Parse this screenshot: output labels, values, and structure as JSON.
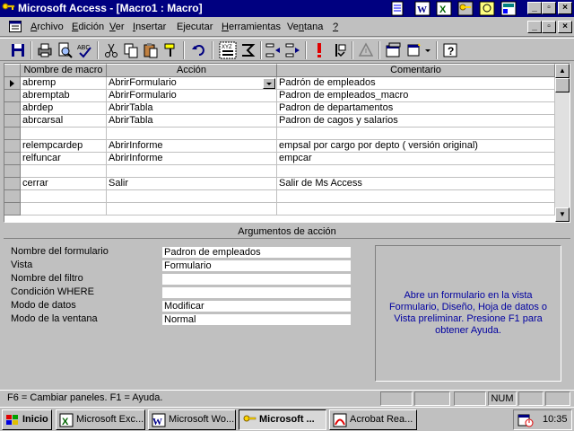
{
  "window": {
    "title": "Microsoft Access - [Macro1 : Macro]",
    "minimize": "_",
    "maximize": "▫",
    "close": "×"
  },
  "menu": {
    "items": [
      {
        "pre": "",
        "ul": "A",
        "post": "rchivo"
      },
      {
        "pre": "",
        "ul": "E",
        "post": "dición"
      },
      {
        "pre": "",
        "ul": "V",
        "post": "er"
      },
      {
        "pre": "",
        "ul": "I",
        "post": "nsertar"
      },
      {
        "pre": "E",
        "ul": "j",
        "post": "ecutar"
      },
      {
        "pre": "",
        "ul": "H",
        "post": "erramientas"
      },
      {
        "pre": "Ve",
        "ul": "n",
        "post": "tana"
      },
      {
        "pre": "",
        "ul": "?",
        "post": ""
      }
    ]
  },
  "grid": {
    "headers": [
      "Nombre de macro",
      "Acción",
      "Comentario"
    ],
    "rows": [
      {
        "name": "abremp",
        "action": "AbrirFormulario",
        "comment": "Padrón de empleados"
      },
      {
        "name": "abremptab",
        "action": "AbrirFormulario",
        "comment": "Padron de empleados_macro"
      },
      {
        "name": "abrdep",
        "action": "AbrirTabla",
        "comment": "Padron de departamentos"
      },
      {
        "name": "abrcarsal",
        "action": "AbrirTabla",
        "comment": "Padron de cagos y salarios"
      },
      {
        "name": "",
        "action": "",
        "comment": ""
      },
      {
        "name": "relempcardep",
        "action": "AbrirInforme",
        "comment": "empsal por cargo por depto ( versión original)"
      },
      {
        "name": "relfuncar",
        "action": "AbrirInforme",
        "comment": "empcar"
      },
      {
        "name": "",
        "action": "",
        "comment": ""
      },
      {
        "name": "cerrar",
        "action": "Salir",
        "comment": "Salir de Ms Access"
      },
      {
        "name": "",
        "action": "",
        "comment": ""
      },
      {
        "name": "",
        "action": "",
        "comment": ""
      }
    ]
  },
  "arguments": {
    "header": "Argumentos de acción",
    "items": [
      {
        "label": "Nombre del formulario",
        "value": "Padron de empleados"
      },
      {
        "label": "Vista",
        "value": "Formulario"
      },
      {
        "label": "Nombre del filtro",
        "value": ""
      },
      {
        "label": "Condición WHERE",
        "value": ""
      },
      {
        "label": "Modo de datos",
        "value": "Modificar"
      },
      {
        "label": "Modo de la ventana",
        "value": "Normal"
      }
    ],
    "help": "Abre un formulario en la vista Formulario, Diseño, Hoja de datos o Vista preliminar. Presione F1 para obtener Ayuda."
  },
  "status": {
    "text": "F6 = Cambiar paneles.  F1 = Ayuda.",
    "num": "NUM"
  },
  "taskbar": {
    "start": "Inicio",
    "buttons": [
      {
        "label": "Microsoft Exc...",
        "icon": "excel-icon"
      },
      {
        "label": "Microsoft Wo...",
        "icon": "word-icon"
      },
      {
        "label": "Microsoft ...",
        "icon": "access-icon"
      },
      {
        "label": "Acrobat Rea...",
        "icon": "acrobat-icon"
      }
    ],
    "clock": "10:35"
  },
  "colors": {
    "titlebar": "#000080",
    "help_text": "#0000a0"
  }
}
